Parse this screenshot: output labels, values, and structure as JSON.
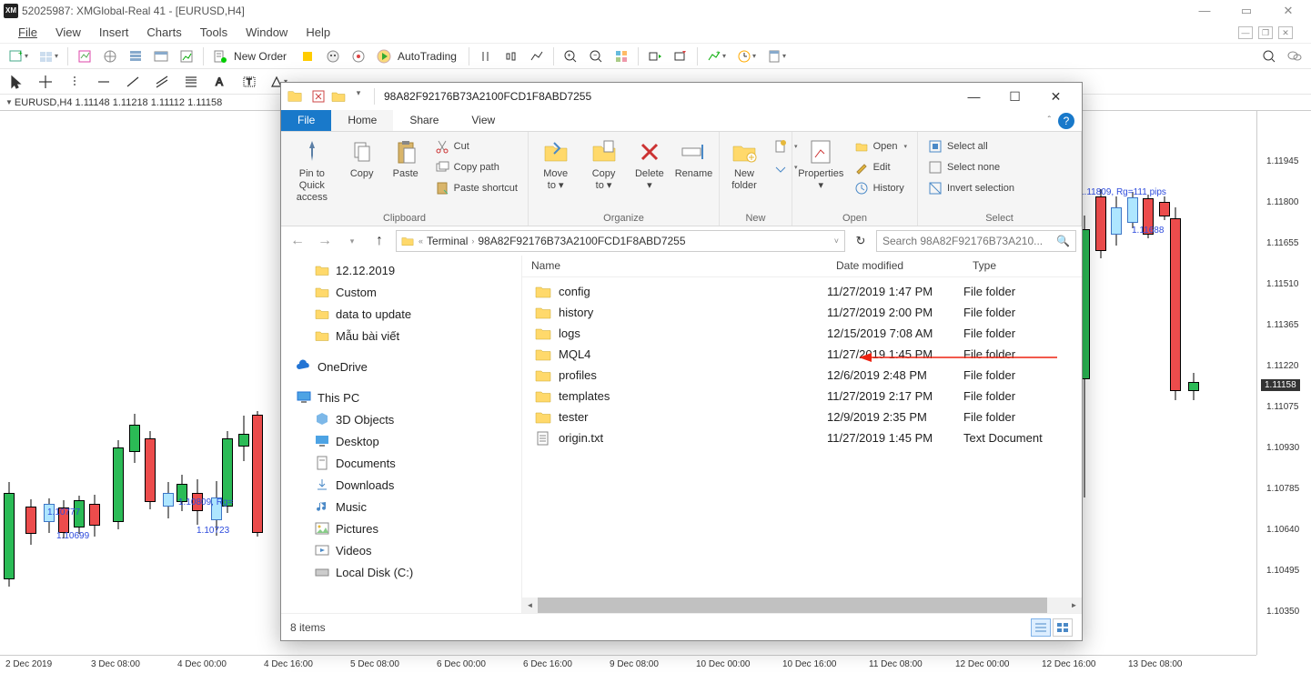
{
  "app": {
    "title": "52025987: XMGlobal-Real 41 - [EURUSD,H4]",
    "menus": [
      "File",
      "View",
      "Insert",
      "Charts",
      "Tools",
      "Window",
      "Help"
    ],
    "toolbar": {
      "new_order": "New Order",
      "auto_trading": "AutoTrading"
    },
    "chart_header": "EURUSD,H4 1.11148 1.11218 1.11112 1.11158",
    "chart_annots": {
      "a1": "1.10777",
      "a2": "1.10699",
      "a3": "1.10809, Rg=",
      "a4": "1.10723",
      "a5": "1.11809, Rg=111 pips",
      "a6": "1.11688"
    },
    "price_label": "1.11158",
    "y_ticks": [
      "1.11945",
      "1.11800",
      "1.11655",
      "1.11510",
      "1.11365",
      "1.11220",
      "1.11075",
      "1.10930",
      "1.10785",
      "1.10640",
      "1.10495",
      "1.10350"
    ],
    "x_ticks": [
      "2 Dec 2019",
      "3 Dec 08:00",
      "4 Dec 00:00",
      "4 Dec 16:00",
      "5 Dec 08:00",
      "6 Dec 00:00",
      "6 Dec 16:00",
      "9 Dec 08:00",
      "10 Dec 00:00",
      "10 Dec 16:00",
      "11 Dec 08:00",
      "12 Dec 00:00",
      "12 Dec 16:00",
      "13 Dec 08:00"
    ]
  },
  "explorer": {
    "window_title": "98A82F92176B73A2100FCD1F8ABD7255",
    "tabs": {
      "file": "File",
      "home": "Home",
      "share": "Share",
      "view": "View"
    },
    "ribbon": {
      "pin": "Pin to Quick access",
      "copy": "Copy",
      "paste": "Paste",
      "cut": "Cut",
      "copy_path": "Copy path",
      "paste_shortcut": "Paste shortcut",
      "clipboard": "Clipboard",
      "move": "Move to",
      "copy_to": "Copy to",
      "delete": "Delete",
      "rename": "Rename",
      "organize": "Organize",
      "new_folder": "New folder",
      "new_item": "New item",
      "easy_access": "Easy access",
      "new": "New",
      "properties": "Properties",
      "open_dd": "Open",
      "edit": "Edit",
      "history": "History",
      "open_group": "Open",
      "select_all": "Select all",
      "select_none": "Select none",
      "invert": "Invert selection",
      "select": "Select"
    },
    "path": {
      "parts": [
        "Terminal",
        "98A82F92176B73A2100FCD1F8ABD7255"
      ]
    },
    "search_placeholder": "Search 98A82F92176B73A210...",
    "nav": {
      "qa": [
        {
          "label": "12.12.2019"
        },
        {
          "label": "Custom"
        },
        {
          "label": "data to update"
        },
        {
          "label": "Mẫu bài viết"
        }
      ],
      "onedrive": "OneDrive",
      "thispc": "This PC",
      "pc": [
        {
          "label": "3D Objects"
        },
        {
          "label": "Desktop"
        },
        {
          "label": "Documents"
        },
        {
          "label": "Downloads"
        },
        {
          "label": "Music"
        },
        {
          "label": "Pictures"
        },
        {
          "label": "Videos"
        },
        {
          "label": "Local Disk (C:)"
        }
      ]
    },
    "cols": {
      "name": "Name",
      "date": "Date modified",
      "type": "Type"
    },
    "files": [
      {
        "name": "config",
        "date": "11/27/2019 1:47 PM",
        "type": "File folder",
        "kind": "folder"
      },
      {
        "name": "history",
        "date": "11/27/2019 2:00 PM",
        "type": "File folder",
        "kind": "folder"
      },
      {
        "name": "logs",
        "date": "12/15/2019 7:08 AM",
        "type": "File folder",
        "kind": "folder"
      },
      {
        "name": "MQL4",
        "date": "11/27/2019 1:45 PM",
        "type": "File folder",
        "kind": "folder"
      },
      {
        "name": "profiles",
        "date": "12/6/2019 2:48 PM",
        "type": "File folder",
        "kind": "folder"
      },
      {
        "name": "templates",
        "date": "11/27/2019 2:17 PM",
        "type": "File folder",
        "kind": "folder"
      },
      {
        "name": "tester",
        "date": "12/9/2019 2:35 PM",
        "type": "File folder",
        "kind": "folder"
      },
      {
        "name": "origin.txt",
        "date": "11/27/2019 1:45 PM",
        "type": "Text Document",
        "kind": "text"
      }
    ],
    "status": "8 items"
  },
  "chart_data": {
    "type": "candlestick",
    "symbol": "EURUSD",
    "timeframe": "H4",
    "ohlc_current": {
      "o": 1.11148,
      "h": 1.11218,
      "l": 1.11112,
      "c": 1.11158
    },
    "ylim": [
      1.1035,
      1.11945
    ],
    "x_categories": [
      "2 Dec 2019",
      "3 Dec 08:00",
      "4 Dec 00:00",
      "4 Dec 16:00",
      "5 Dec 08:00",
      "6 Dec 00:00",
      "6 Dec 16:00",
      "9 Dec 08:00",
      "10 Dec 00:00",
      "10 Dec 16:00",
      "11 Dec 08:00",
      "12 Dec 00:00",
      "12 Dec 16:00",
      "13 Dec 08:00"
    ],
    "annotations": [
      {
        "label": "1.10777",
        "value": 1.10777
      },
      {
        "label": "1.10699",
        "value": 1.10699
      },
      {
        "label": "1.10809",
        "value": 1.10809
      },
      {
        "label": "1.10723",
        "value": 1.10723
      },
      {
        "label": "1.11809",
        "value": 1.11809,
        "note": "Rg=111 pips"
      },
      {
        "label": "1.11688",
        "value": 1.11688
      }
    ],
    "price_marker": 1.11158
  }
}
